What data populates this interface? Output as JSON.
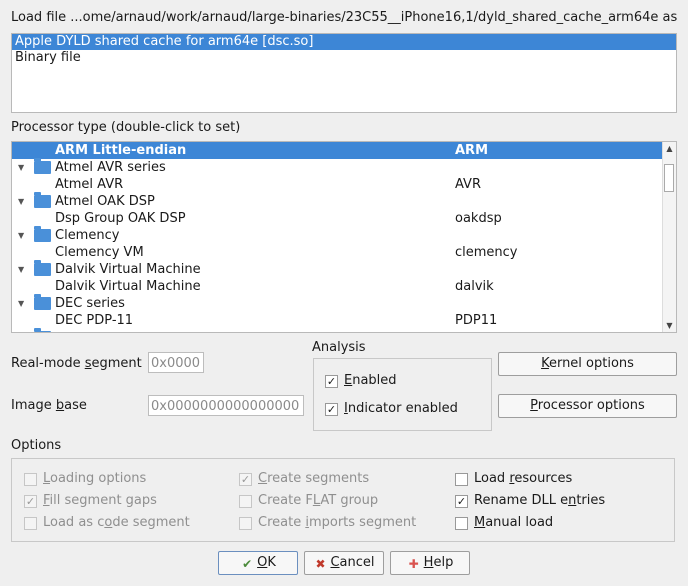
{
  "load_file": {
    "label": "Load file",
    "path": "...ome/arnaud/work/arnaud/large-binaries/23C55__iPhone16,1/dyld_shared_cache_arm64e as"
  },
  "file_types": [
    {
      "label": "Apple DYLD shared cache for arm64e [dsc.so]",
      "selected": true
    },
    {
      "label": "Binary file",
      "selected": false
    }
  ],
  "processor": {
    "label": "Processor type (double-click to set)",
    "rows": [
      {
        "name": "ARM Little-endian",
        "value": "ARM",
        "kind": "item",
        "selected": true
      },
      {
        "name": "Atmel AVR series",
        "value": "",
        "kind": "group"
      },
      {
        "name": "Atmel AVR",
        "value": "AVR",
        "kind": "item"
      },
      {
        "name": "Atmel OAK DSP",
        "value": "",
        "kind": "group"
      },
      {
        "name": "Dsp Group OAK DSP",
        "value": "oakdsp",
        "kind": "item"
      },
      {
        "name": "Clemency",
        "value": "",
        "kind": "group"
      },
      {
        "name": "Clemency VM",
        "value": "clemency",
        "kind": "item"
      },
      {
        "name": "Dalvik Virtual Machine",
        "value": "",
        "kind": "group"
      },
      {
        "name": "Dalvik Virtual Machine",
        "value": "dalvik",
        "kind": "item"
      },
      {
        "name": "DEC series",
        "value": "",
        "kind": "group"
      },
      {
        "name": "DEC PDP-11",
        "value": "PDP11",
        "kind": "item"
      }
    ]
  },
  "realmode": {
    "label_pre": "Real-mode ",
    "label_u": "s",
    "label_post": "egment",
    "value": "0x0000"
  },
  "imagebase": {
    "label_pre": "Image ",
    "label_u": "b",
    "label_post": "ase",
    "value": "0x0000000000000000"
  },
  "analysis": {
    "label": "Analysis",
    "enabled": {
      "u": "E",
      "rest": "nabled",
      "checked": true
    },
    "indicator": {
      "u": "I",
      "rest": "ndicator enabled",
      "checked": true
    }
  },
  "buttons": {
    "kernel": {
      "u": "K",
      "rest": "ernel options"
    },
    "processor": {
      "u": "P",
      "rest": "rocessor options"
    },
    "ok": {
      "u": "O",
      "rest": "K"
    },
    "cancel": {
      "u": "C",
      "rest": "ancel"
    },
    "help": {
      "u": "H",
      "rest": "elp"
    }
  },
  "options": {
    "label": "Options",
    "loading": {
      "pre": "",
      "u": "L",
      "post": "oading options",
      "checked": false,
      "disabled": true
    },
    "fill_gaps": {
      "pre": "",
      "u": "F",
      "post": "ill segment gaps",
      "checked": true,
      "disabled": true
    },
    "code_segment": {
      "pre": "Load as c",
      "u": "o",
      "post": "de segment",
      "checked": false,
      "disabled": true
    },
    "create_segments": {
      "pre": "",
      "u": "C",
      "post": "reate segments",
      "checked": true,
      "disabled": true
    },
    "flat_group": {
      "pre": "Create F",
      "u": "L",
      "post": "AT group",
      "checked": false,
      "disabled": true
    },
    "imports_segment": {
      "pre": "Create ",
      "u": "i",
      "post": "mports segment",
      "checked": false,
      "disabled": true
    },
    "resources": {
      "pre": "Load ",
      "u": "r",
      "post": "esources",
      "checked": false,
      "disabled": false
    },
    "rename_dll": {
      "pre": "Rename DLL e",
      "u": "n",
      "post": "tries",
      "checked": true,
      "disabled": false
    },
    "manual_load": {
      "pre": "",
      "u": "M",
      "post": "anual load",
      "checked": false,
      "disabled": false
    }
  }
}
